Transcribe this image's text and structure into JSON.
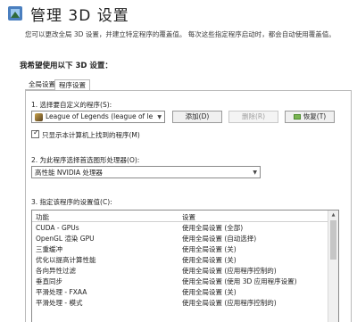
{
  "header": {
    "title": "管理 3D 设置",
    "description": "您可以更改全局 3D 设置，并建立特定程序的覆盖值。 每次这些指定程序启动时，都会自动使用覆盖值。"
  },
  "section_title": "我希望使用以下 3D 设置：",
  "tabs": [
    {
      "label": "全局设置",
      "active": false
    },
    {
      "label": "程序设置",
      "active": true
    }
  ],
  "program_settings": {
    "step1_label": "1. 选择要自定义的程序(S):",
    "selected_program": "League of Legends (league of lege...",
    "add_button": "添加(D)",
    "delete_button": "删除(R)",
    "restore_button": "恢复(T)",
    "only_show_found_label": "只显示本计算机上找到的程序(M)",
    "only_show_found_checked": true,
    "step2_label": "2. 为此程序选择首选图形处理器(O):",
    "selected_gpu": "高性能 NVIDIA 处理器",
    "step3_label": "3. 指定该程序的设置值(C):",
    "table": {
      "col_feature": "功能",
      "col_setting": "设置",
      "rows": [
        {
          "feature": "CUDA - GPUs",
          "setting": "使用全局设置 (全部)"
        },
        {
          "feature": "OpenGL 渲染 GPU",
          "setting": "使用全局设置 (自动选择)"
        },
        {
          "feature": "三重缓冲",
          "setting": "使用全局设置 (关)"
        },
        {
          "feature": "优化以提高计算性能",
          "setting": "使用全局设置 (关)"
        },
        {
          "feature": "各向异性过滤",
          "setting": "使用全局设置 (应用程序控制的)"
        },
        {
          "feature": "垂直同步",
          "setting": "使用全局设置 (使用 3D 应用程序设置)"
        },
        {
          "feature": "平滑处理 - FXAA",
          "setting": "使用全局设置 (关)"
        },
        {
          "feature": "平滑处理 - 模式",
          "setting": "使用全局设置 (应用程序控制的)"
        }
      ]
    }
  },
  "colors": {
    "accent_green": "#7ab552"
  }
}
